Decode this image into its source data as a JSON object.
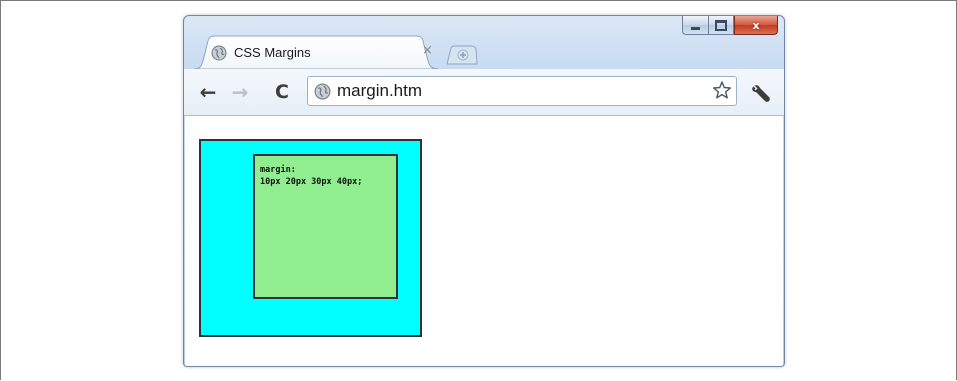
{
  "window": {
    "controls": {
      "minimize_icon": "minimize-icon",
      "maximize_icon": "maximize-icon",
      "close_label": "x"
    }
  },
  "tabs": [
    {
      "title": "CSS Margins",
      "close_label": "×",
      "icon": "globe-icon"
    }
  ],
  "new_tab": {
    "icon": "plus-icon"
  },
  "toolbar": {
    "back_label": "←",
    "forward_label": "→",
    "reload_label": "C",
    "url": "margin.htm",
    "bookmark_icon": "star-icon",
    "menu_icon": "wrench-icon"
  },
  "page": {
    "outer_box": {
      "background": "#00ffff"
    },
    "inner_box": {
      "background": "#90ee90",
      "lines": [
        "margin:",
        "10px 20px 30px 40px;"
      ]
    }
  }
}
